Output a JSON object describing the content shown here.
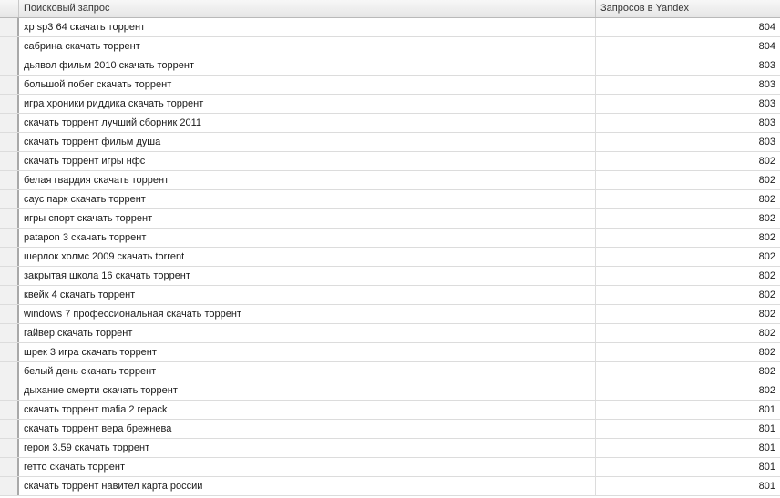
{
  "table": {
    "columns": {
      "query": "Поисковый запрос",
      "count": "Запросов в Yandex"
    },
    "rows": [
      {
        "query": "xp sp3 64 скачать торрент",
        "count": "804"
      },
      {
        "query": "сабрина скачать торрент",
        "count": "804"
      },
      {
        "query": "дьявол фильм 2010 скачать торрент",
        "count": "803"
      },
      {
        "query": "большой побег скачать торрент",
        "count": "803"
      },
      {
        "query": "игра хроники риддика скачать торрент",
        "count": "803"
      },
      {
        "query": "скачать торрент лучший сборник 2011",
        "count": "803"
      },
      {
        "query": "скачать торрент фильм душа",
        "count": "803"
      },
      {
        "query": "скачать торрент игры нфс",
        "count": "802"
      },
      {
        "query": "белая гвардия скачать торрент",
        "count": "802"
      },
      {
        "query": "саус парк скачать торрент",
        "count": "802"
      },
      {
        "query": "игры спорт скачать торрент",
        "count": "802"
      },
      {
        "query": "patapon 3 скачать торрент",
        "count": "802"
      },
      {
        "query": "шерлок холмс 2009 скачать torrent",
        "count": "802"
      },
      {
        "query": "закрытая школа 16 скачать торрент",
        "count": "802"
      },
      {
        "query": "квейк 4 скачать торрент",
        "count": "802"
      },
      {
        "query": "windows 7 профессиональная скачать торрент",
        "count": "802"
      },
      {
        "query": "гайвер скачать торрент",
        "count": "802"
      },
      {
        "query": "шрек 3 игра скачать торрент",
        "count": "802"
      },
      {
        "query": "белый день скачать торрент",
        "count": "802"
      },
      {
        "query": "дыхание смерти скачать торрент",
        "count": "802"
      },
      {
        "query": "скачать торрент mafia 2 repack",
        "count": "801"
      },
      {
        "query": "скачать торрент вера брежнева",
        "count": "801"
      },
      {
        "query": "герои 3.59 скачать торрент",
        "count": "801"
      },
      {
        "query": "гетто скачать торрент",
        "count": "801"
      },
      {
        "query": "скачать торрент навител карта россии",
        "count": "801"
      }
    ]
  }
}
